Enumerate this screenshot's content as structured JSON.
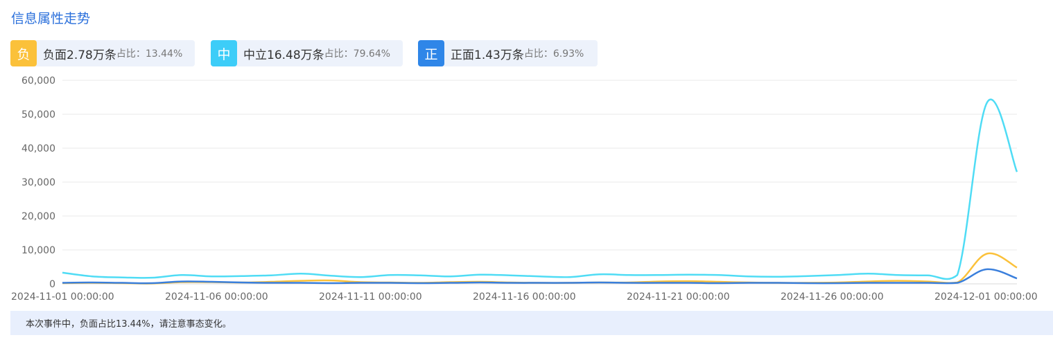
{
  "header": {
    "title": "信息属性走势"
  },
  "legend": [
    {
      "key": "neg",
      "badge": "负",
      "label": "负面2.78万条",
      "ratio_label": "占比：",
      "ratio_value": "13.44%",
      "color": "#fbc13a"
    },
    {
      "key": "neu",
      "badge": "中",
      "label": "中立16.48万条",
      "ratio_label": "占比：",
      "ratio_value": "79.64%",
      "color": "#3dcdf8"
    },
    {
      "key": "pos",
      "badge": "正",
      "label": "正面1.43万条",
      "ratio_label": "占比：",
      "ratio_value": "6.93%",
      "color": "#2f86e8"
    }
  ],
  "note": "本次事件中，负面占比13.44%，请注意事态变化。",
  "chart_data": {
    "type": "line",
    "title": "",
    "x_tick_labels": [
      "2024-11-01 00:00:00",
      "2024-11-06 00:00:00",
      "2024-11-11 00:00:00",
      "2024-11-16 00:00:00",
      "2024-11-21 00:00:00",
      "2024-11-26 00:00:00",
      "2024-12-01 00:00:00"
    ],
    "y_tick_labels": [
      "0",
      "10,000",
      "20,000",
      "30,000",
      "40,000",
      "50,000",
      "60,000"
    ],
    "ylim": [
      0,
      60000
    ],
    "grid": true,
    "x": [
      "2024-11-01",
      "2024-11-02",
      "2024-11-03",
      "2024-11-04",
      "2024-11-05",
      "2024-11-06",
      "2024-11-07",
      "2024-11-08",
      "2024-11-09",
      "2024-11-10",
      "2024-11-11",
      "2024-11-12",
      "2024-11-13",
      "2024-11-14",
      "2024-11-15",
      "2024-11-16",
      "2024-11-17",
      "2024-11-18",
      "2024-11-19",
      "2024-11-20",
      "2024-11-21",
      "2024-11-22",
      "2024-11-23",
      "2024-11-24",
      "2024-11-25",
      "2024-11-26",
      "2024-11-27",
      "2024-11-28",
      "2024-11-29",
      "2024-11-30",
      "2024-12-01",
      "2024-12-02",
      "2024-12-03"
    ],
    "series": [
      {
        "key": "neu",
        "color": "#4fdcf5",
        "values": [
          3300,
          2200,
          1900,
          1800,
          2600,
          2200,
          2300,
          2500,
          3000,
          2400,
          2000,
          2600,
          2500,
          2200,
          2700,
          2500,
          2200,
          2000,
          2800,
          2600,
          2600,
          2700,
          2600,
          2200,
          2100,
          2300,
          2600,
          3000,
          2600,
          2500,
          2600,
          53500,
          33000
        ]
      },
      {
        "key": "neg",
        "color": "#fbc13a",
        "values": [
          200,
          300,
          200,
          100,
          500,
          500,
          400,
          600,
          900,
          1000,
          500,
          400,
          300,
          500,
          600,
          400,
          300,
          300,
          400,
          400,
          700,
          800,
          600,
          400,
          300,
          300,
          400,
          700,
          900,
          700,
          400,
          8900,
          4800
        ]
      },
      {
        "key": "pos",
        "color": "#3a7fdc",
        "values": [
          300,
          400,
          300,
          200,
          700,
          600,
          400,
          300,
          300,
          200,
          300,
          300,
          200,
          300,
          400,
          300,
          300,
          300,
          400,
          300,
          300,
          300,
          200,
          300,
          300,
          200,
          200,
          300,
          300,
          300,
          300,
          4300,
          1600
        ]
      }
    ]
  }
}
